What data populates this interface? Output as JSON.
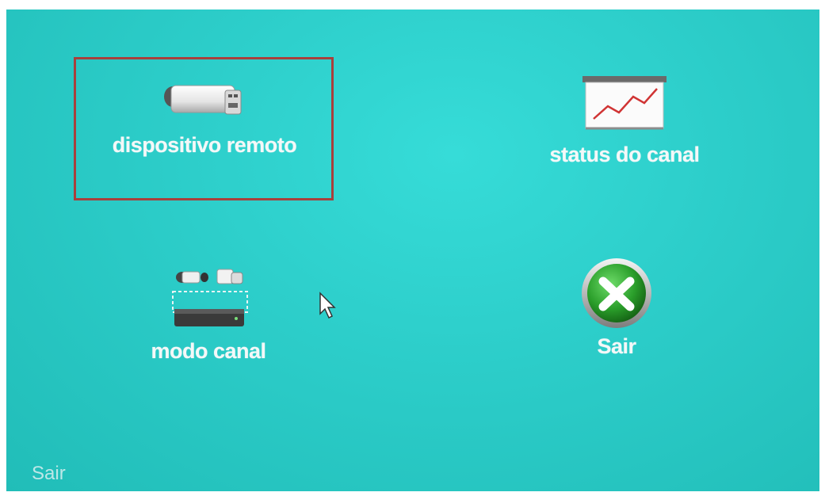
{
  "menu": {
    "items": [
      {
        "label": "dispositivo remoto",
        "icon": "camera-icon",
        "selected": true
      },
      {
        "label": "status do canal",
        "icon": "chart-board-icon",
        "selected": false
      },
      {
        "label": "modo canal",
        "icon": "channel-mode-icon",
        "selected": false
      },
      {
        "label": "Sair",
        "icon": "close-icon",
        "selected": false
      }
    ]
  },
  "footer": {
    "hint": "Sair"
  },
  "colors": {
    "background": "#2ccdc9",
    "selection_border": "#a8403c",
    "label": "#f4f8f8"
  }
}
